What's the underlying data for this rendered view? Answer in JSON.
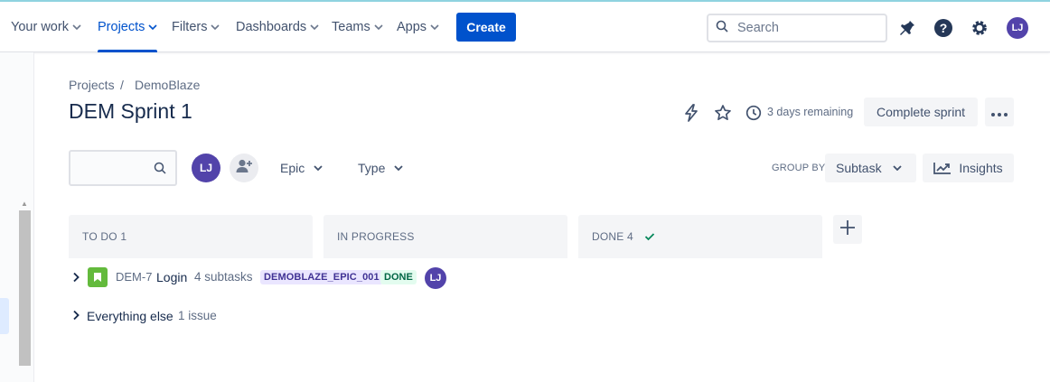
{
  "nav": {
    "your_work": "Your work",
    "projects": "Projects",
    "filters": "Filters",
    "dashboards": "Dashboards",
    "teams": "Teams",
    "apps": "Apps",
    "create": "Create",
    "search_placeholder": "Search",
    "avatar_initials": "LJ"
  },
  "breadcrumb": {
    "projects": "Projects",
    "separator": "/",
    "project": "DemoBlaze"
  },
  "sprint": {
    "title": "DEM Sprint 1",
    "remaining": "3 days remaining",
    "complete_button": "Complete sprint"
  },
  "filters": {
    "avatar_initials": "LJ",
    "epic": "Epic",
    "type": "Type",
    "group_by_label": "GROUP BY",
    "group_by_value": "Subtask",
    "insights": "Insights"
  },
  "columns": [
    {
      "label": "TO DO 1"
    },
    {
      "label": "IN PROGRESS"
    },
    {
      "label": "DONE 4"
    }
  ],
  "rows": {
    "story": {
      "key": "DEM-7",
      "summary": "Login",
      "subtasks": "4 subtasks",
      "epic": "DEMOBLAZE_EPIC_001",
      "status": "DONE",
      "assignee_initials": "LJ"
    },
    "everything_else": {
      "label": "Everything else",
      "count": "1 issue"
    }
  },
  "colors": {
    "brand": "#0052cc",
    "avatar": "#5243aa",
    "story_icon": "#63ba3c",
    "done_check": "#00875a"
  }
}
